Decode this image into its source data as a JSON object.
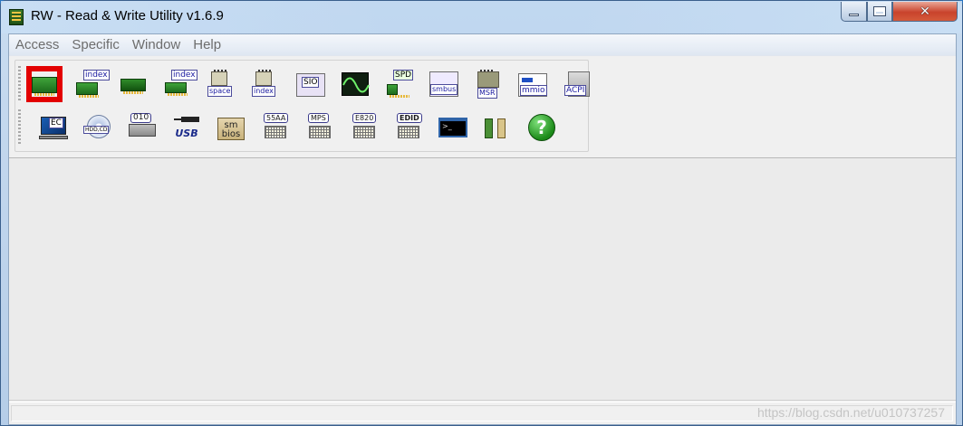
{
  "window": {
    "title": "RW - Read & Write Utility v1.6.9",
    "controls": {
      "minimize": "",
      "maximize": "",
      "close": "✕"
    }
  },
  "menu": [
    {
      "label": "Access"
    },
    {
      "label": "Specific"
    },
    {
      "label": "Window"
    },
    {
      "label": "Help"
    }
  ],
  "toolbar": {
    "row1": [
      {
        "name": "pci-button",
        "icon": "pci-board-icon",
        "tag": "",
        "selected": true
      },
      {
        "name": "pci-index-button",
        "icon": "pci-index-icon",
        "tag": "index"
      },
      {
        "name": "memory-button",
        "icon": "memory-module-icon",
        "tag": ""
      },
      {
        "name": "memory-index-button",
        "icon": "memory-index-icon",
        "tag": "index"
      },
      {
        "name": "io-space-button",
        "icon": "io-space-icon",
        "tag": "space"
      },
      {
        "name": "io-index-button",
        "icon": "io-index-icon",
        "tag": "index"
      },
      {
        "name": "sio-button",
        "icon": "superio-icon",
        "tag": "SIO"
      },
      {
        "name": "oscilloscope-button",
        "icon": "oscilloscope-icon",
        "tag": ""
      },
      {
        "name": "spd-button",
        "icon": "spd-icon",
        "tag": "SPD"
      },
      {
        "name": "smbus-button",
        "icon": "smbus-icon",
        "tag": "smbus"
      },
      {
        "name": "msr-button",
        "icon": "cpu-msr-icon",
        "tag": "MSR"
      },
      {
        "name": "mmio-button",
        "icon": "mmio-icon",
        "tag": "mmio"
      },
      {
        "name": "acpi-button",
        "icon": "acpi-icon",
        "tag": "ACPI"
      }
    ],
    "row2": [
      {
        "name": "ec-button",
        "icon": "embedded-controller-icon",
        "tag": "EC"
      },
      {
        "name": "hdd-cd-button",
        "icon": "hdd-cd-icon",
        "tag": "HDD,CD"
      },
      {
        "name": "disk-sector-button",
        "icon": "disk-sector-icon",
        "tag": "010"
      },
      {
        "name": "usb-button",
        "icon": "usb-icon",
        "tag": "USB"
      },
      {
        "name": "smbios-button",
        "icon": "smbios-icon",
        "tag": "sm bios"
      },
      {
        "name": "rom-55aa-button",
        "icon": "rom-55aa-icon",
        "tag": "55AA"
      },
      {
        "name": "mps-button",
        "icon": "mps-table-icon",
        "tag": "MPS"
      },
      {
        "name": "e820-button",
        "icon": "e820-icon",
        "tag": "E820"
      },
      {
        "name": "edid-button",
        "icon": "edid-icon",
        "tag": "EDID"
      },
      {
        "name": "command-button",
        "icon": "terminal-icon",
        "tag": ""
      },
      {
        "name": "devices-button",
        "icon": "slots-icon",
        "tag": ""
      },
      {
        "name": "help-button",
        "icon": "question-icon",
        "tag": "?"
      }
    ]
  },
  "watermark": "https://blog.csdn.net/u010737257"
}
